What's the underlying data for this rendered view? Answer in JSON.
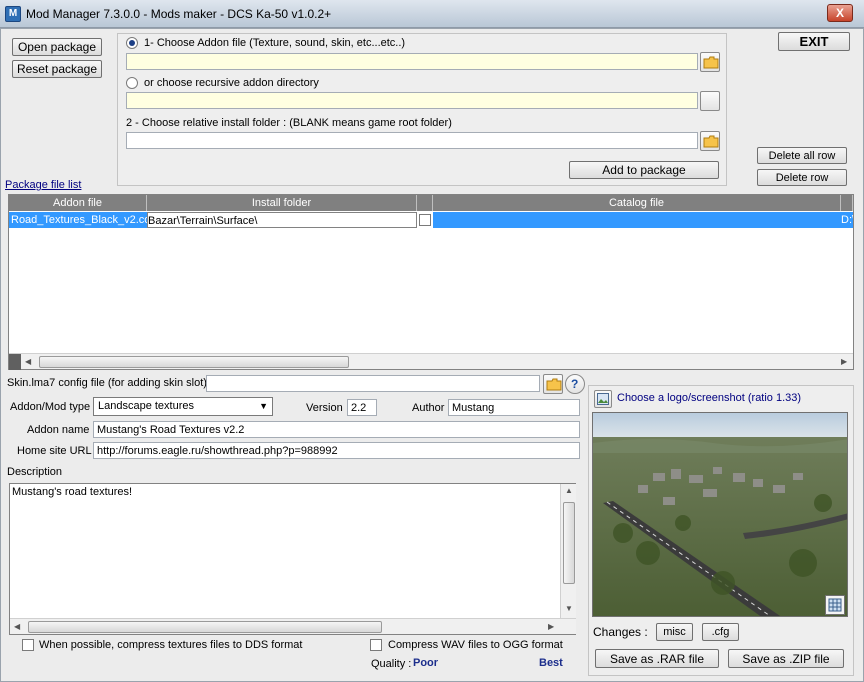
{
  "window": {
    "title": "Mod Manager 7.3.0.0 - Mods maker - DCS Ka-50 v1.0.2+",
    "close_label": "X"
  },
  "left_buttons": {
    "open_package": "Open package",
    "reset_package": "Reset package"
  },
  "exit_label": "EXIT",
  "source": {
    "addon_file_label": "1- Choose Addon file (Texture, sound, skin, etc...etc..)",
    "addon_file_value": "",
    "recursive_dir_label": "or choose recursive addon directory",
    "recursive_dir_value": "",
    "install_folder_label": "2 - Choose relative install folder : (BLANK means game root folder)",
    "install_folder_value": "",
    "add_to_package": "Add to package"
  },
  "row_buttons": {
    "delete_all": "Delete all row",
    "delete_row": "Delete row"
  },
  "package_list_label": "Package file list",
  "grid": {
    "columns": [
      "Addon file",
      "Install folder",
      "Catalog file"
    ],
    "rows": [
      {
        "addon_file": "Road_Textures_Black_v2.co",
        "install_folder": "Bazar\\Terrain\\Surface\\",
        "catalog_file": "",
        "extra": "D:\\"
      }
    ]
  },
  "config": {
    "skin_label": "Skin.lma7 config file (for adding skin slot)",
    "skin_value": "",
    "help_label": "?",
    "mod_type_label": "Addon/Mod type",
    "mod_type_value": "Landscape textures",
    "version_label": "Version",
    "version_value": "2.2",
    "author_label": "Author",
    "author_value": "Mustang",
    "addon_name_label": "Addon name",
    "addon_name_value": "Mustang's Road Textures v2.2",
    "home_url_label": "Home site URL",
    "home_url_value": "http://forums.eagle.ru/showthread.php?p=988992",
    "description_label": "Description",
    "description_value": "Mustang's road textures!"
  },
  "options": {
    "compress_dds": "When possible, compress textures files to DDS format",
    "compress_wav": "Compress WAV files to OGG format",
    "quality_label": "Quality :",
    "quality_poor": "Poor",
    "quality_best": "Best"
  },
  "logo": {
    "choose_label": "Choose a logo/screenshot (ratio 1.33)"
  },
  "changes": {
    "label": "Changes :",
    "misc": "misc",
    "cfg": ".cfg"
  },
  "save": {
    "rar": "Save as .RAR file",
    "zip": "Save as .ZIP file"
  },
  "colors": {
    "selection": "#3399ff",
    "grid_header": "#808080",
    "quality_text": "#1c2e8c"
  }
}
